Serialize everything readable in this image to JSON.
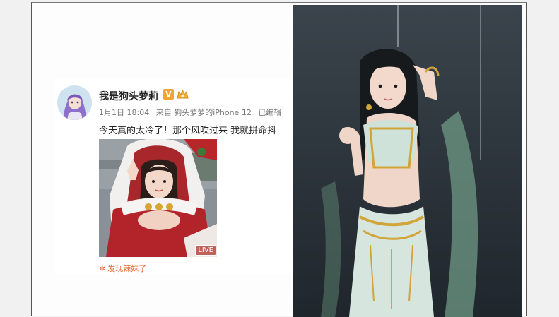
{
  "post": {
    "username": "我是狗头萝莉",
    "verified_badge": "V",
    "badge_icon": "crown-fan-icon",
    "time": "1月1日 18:04",
    "source": "来自 狗头萝萝的iPhone 12",
    "edited": "已编辑",
    "text": "今天真的太冷了！那个风吹过来 我就拼命抖",
    "photo_badge": "LIVE",
    "topic_icon": "flower-icon",
    "topic": "发现辣妹了"
  },
  "colors": {
    "verified_badge": "#f2a33a",
    "topic": "#e36b3a",
    "meta_text": "#777777"
  },
  "images": {
    "avatar": "purple-haired-anime-avatar",
    "post_photo": "woman-in-red-santa-costume-selfie",
    "big_photo": "woman-in-dunhuang-costume-dark-stage"
  }
}
